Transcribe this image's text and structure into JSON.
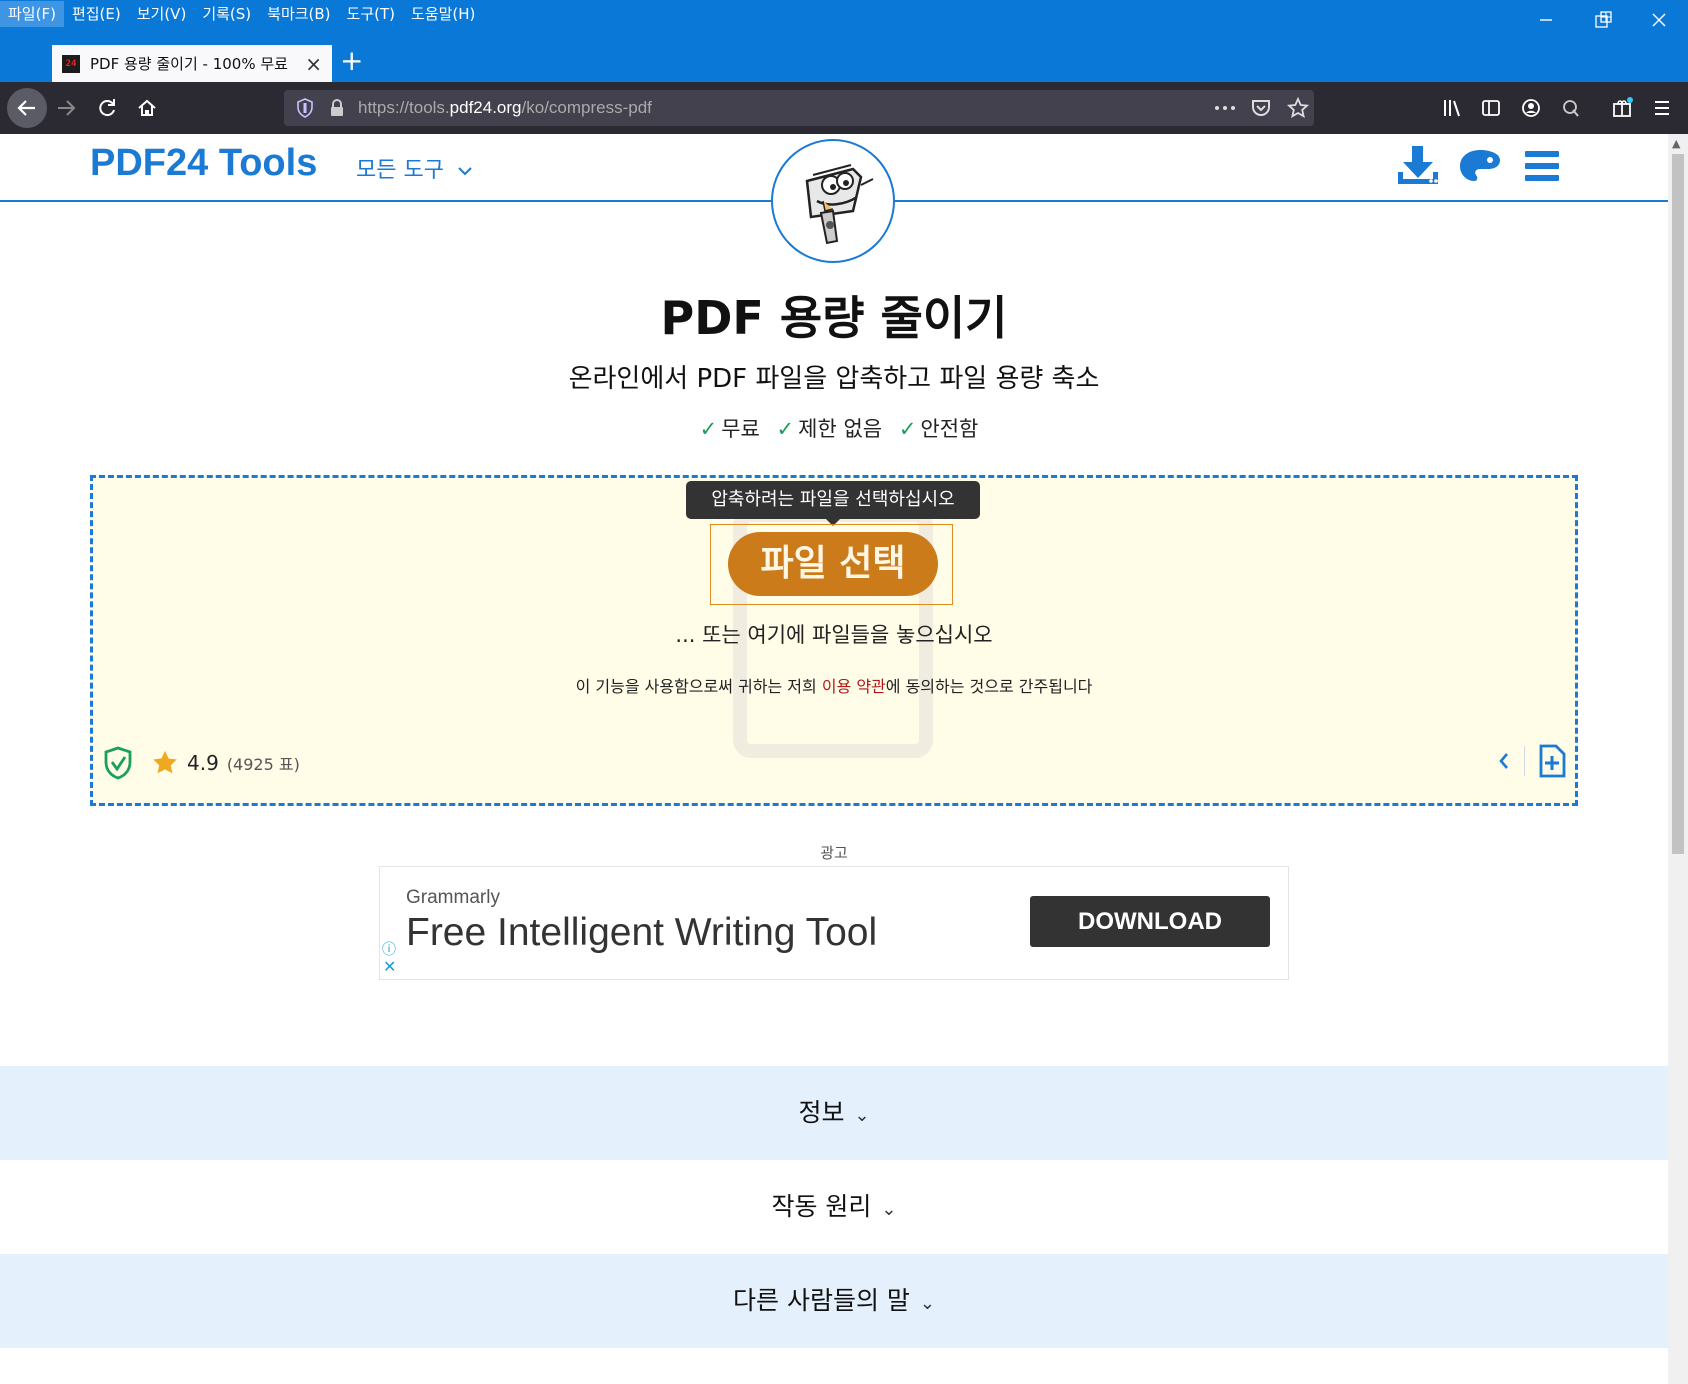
{
  "browser": {
    "menu": [
      "파일(F)",
      "편집(E)",
      "보기(V)",
      "기록(S)",
      "북마크(B)",
      "도구(T)",
      "도움말(H)"
    ],
    "tab_title": "PDF 용량 줄이기 - 100% 무료",
    "favicon_text": "24",
    "url_prefix": "https://tools.",
    "url_host": "pdf24.org",
    "url_path": "/ko/compress-pdf"
  },
  "site": {
    "logo": "PDF24 Tools",
    "all_tools": "모든 도구"
  },
  "hero": {
    "title": "PDF 용량 줄이기",
    "subtitle": "온라인에서 PDF 파일을 압축하고 파일 용량 축소",
    "features": [
      "무료",
      "제한 없음",
      "안전함"
    ]
  },
  "dropzone": {
    "tooltip": "압축하려는 파일을 선택하십시오",
    "choose_button": "파일 선택",
    "drop_hint": "... 또는 여기에 파일들을 놓으십시오",
    "terms_before": "이 기능을 사용함으로써 귀하는 저희 ",
    "terms_link": "이용 약관",
    "terms_after": "에 동의하는 것으로 간주됩니다",
    "rating_score": "4.9",
    "rating_votes": "(4925 표)"
  },
  "ad": {
    "label": "광고",
    "brand": "Grammarly",
    "headline": "Free Intelligent Writing Tool",
    "button": "DOWNLOAD"
  },
  "sections": [
    "정보",
    "작동 원리",
    "다른 사람들의 말"
  ],
  "colors": {
    "brand_blue": "#1a7ad4",
    "choose_orange": "#cc7b1a",
    "check_green": "#1aa05a",
    "dropzone_bg": "#fffce8"
  }
}
